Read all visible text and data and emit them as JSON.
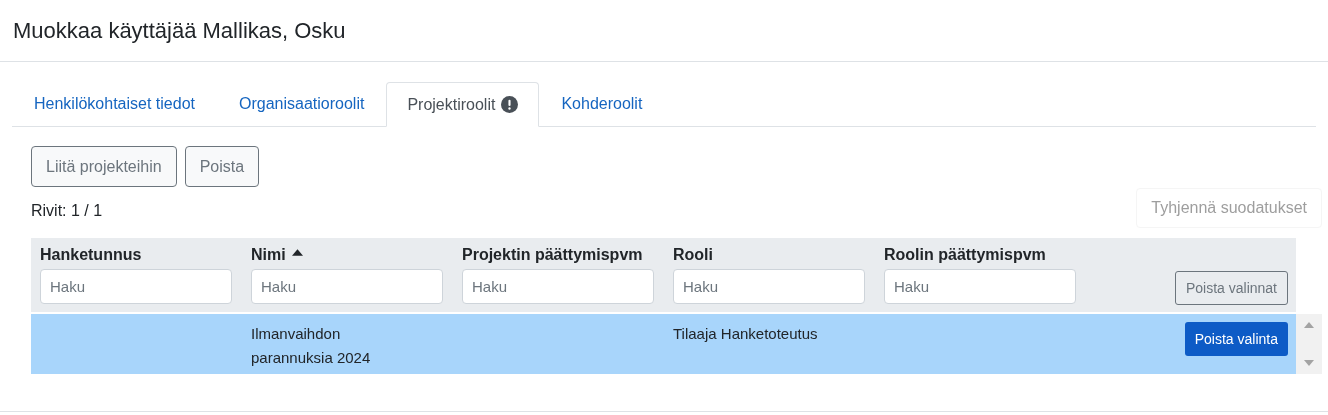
{
  "dialog": {
    "title": "Muokkaa käyttäjää Mallikas, Osku"
  },
  "tabs": [
    {
      "label": "Henkilökohtaiset tiedot",
      "selected": false,
      "alert": false
    },
    {
      "label": "Organisaatioroolit",
      "selected": false,
      "alert": false
    },
    {
      "label": "Projektiroolit",
      "selected": true,
      "alert": true
    },
    {
      "label": "Kohderoolit",
      "selected": false,
      "alert": false
    }
  ],
  "toolbar": {
    "buttons": [
      "Liitä projekteihin",
      "Poista"
    ]
  },
  "row_count": "Rivit: 1 / 1",
  "clear_filters_button": "Tyhjennä suodatukset",
  "table": {
    "columns": [
      {
        "label": "Hanketunnus",
        "sorted": false,
        "filter_placeholder": "Haku"
      },
      {
        "label": "Nimi",
        "sorted": true,
        "filter_placeholder": "Haku"
      },
      {
        "label": "Projektin päättymispvm",
        "sorted": false,
        "filter_placeholder": "Haku"
      },
      {
        "label": "Rooli",
        "sorted": false,
        "filter_placeholder": "Haku"
      },
      {
        "label": "Roolin päättymispvm",
        "sorted": false,
        "filter_placeholder": "Haku"
      }
    ],
    "clear_selections_button": "Poista valinnat",
    "rows": [
      {
        "cells": [
          "",
          "Ilmanvaihdon\nparannuksia 2024",
          "",
          "Tilaaja Hanketoteutus",
          ""
        ],
        "selected": true,
        "action": "Poista valinta"
      }
    ]
  }
}
